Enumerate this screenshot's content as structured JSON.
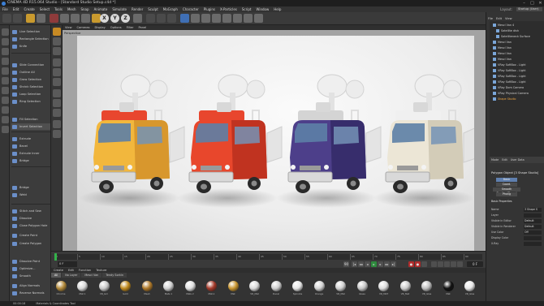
{
  "window": {
    "title": "CINEMA 4D R15.064 Studio - [Standard Studio Setup.c4d *]",
    "controls": [
      "–",
      "□",
      "✕"
    ]
  },
  "menubar": {
    "items": [
      "File",
      "Edit",
      "Create",
      "Select",
      "Tools",
      "Mesh",
      "Snap",
      "Animate",
      "Simulate",
      "Render",
      "Sculpt",
      "MoGraph",
      "Character",
      "Plugins",
      "X-Particles",
      "Script",
      "Window",
      "Help"
    ],
    "layout_label": "Layout:",
    "layout_value": "Startup (User)"
  },
  "toolbar": {
    "axis_labels": [
      "X",
      "Y",
      "Z"
    ]
  },
  "left_panel": {
    "items": [
      "Live Selection",
      "Rectangle Selection",
      "Knife",
      "",
      "Slide Connection",
      "Outline All",
      "Grow Selection",
      "Shrink Selection",
      "Loop Selection",
      "Ring Selection",
      "",
      "Fill Selection",
      "Invert Selection",
      "Extrude",
      "Bevel",
      "Extrude Inner",
      "Bridge",
      "",
      "Bridge",
      "Weld",
      "",
      "Stitch and Sew",
      "Dissolve",
      "Close Polygon Hole",
      "Create Point",
      "Create Polygon",
      "",
      "Dissolve Point",
      "Optimize...",
      "Smooth",
      "Align Normals",
      "Reverse Normals"
    ]
  },
  "viewport": {
    "menu": [
      "View",
      "Cameras",
      "Display",
      "Options",
      "Filter",
      "Panel"
    ],
    "label": "Perspective"
  },
  "timeline": {
    "ticks": [
      "0",
      "5",
      "10",
      "15",
      "20",
      "25",
      "30",
      "35",
      "40",
      "45",
      "50",
      "55",
      "60",
      "65",
      "70",
      "75",
      "80",
      "85",
      "90"
    ],
    "current_frame": "0 F",
    "end_frame": "90 F",
    "frame_right": "0 F"
  },
  "materials": {
    "tabs": [
      "Create",
      "Edit",
      "Function",
      "Texture"
    ],
    "filters": [
      "All",
      "No Layer",
      "Mesci Van",
      "Tendy Sorkin"
    ],
    "items": [
      {
        "name": "Chrome",
        "color": "#b38a3a"
      },
      {
        "name": "Mat 1",
        "color": "#d9d9d9"
      },
      {
        "name": "VR_Gm",
        "color": "#c9c9c9"
      },
      {
        "name": "Gold",
        "color": "#c08a1e"
      },
      {
        "name": "Mesh",
        "color": "#b07a2a"
      },
      {
        "name": "Mats 1",
        "color": "#d2d2d2"
      },
      {
        "name": "Mats 2",
        "color": "#e0e0e0"
      },
      {
        "name": "Mat.1",
        "color": "#a53a2a"
      },
      {
        "name": "Mat",
        "color": "#c8952f"
      },
      {
        "name": "VR_Mat",
        "color": "#dadada"
      },
      {
        "name": "Decal",
        "color": "#cfcfcf"
      },
      {
        "name": "Sprinkle",
        "color": "#e6e6e6"
      },
      {
        "name": "Orange",
        "color": "#d4d4d4"
      },
      {
        "name": "VR_Mat",
        "color": "#d0d0d0"
      },
      {
        "name": "Glass",
        "color": "#c7c7c7"
      },
      {
        "name": "VR_MAT",
        "color": "#dcdcdc"
      },
      {
        "name": "VR_Mat",
        "color": "#cccccc"
      },
      {
        "name": "VR_Glas",
        "color": "#bfbfbf"
      },
      {
        "name": "Mat",
        "color": "#111111"
      },
      {
        "name": "VR_Glas",
        "color": "#e8e8e8"
      }
    ]
  },
  "objects": {
    "menu": [
      "File",
      "Edit",
      "View"
    ],
    "items": [
      "Mesci Van 4",
      "Satellite dish",
      "Satelliteneck Surface",
      "Mesci Van",
      "Mesci Van",
      "Mesci Van",
      "Mesci Van",
      "VRay SoftBox - Light",
      "VRay SoftBox - Light",
      "VRay SoftBox - Light",
      "VRay SoftBox - Light",
      "VRay Dom Camera",
      "VRay Physical Camera",
      "Shape Studio"
    ],
    "selected_index": 13
  },
  "attributes": {
    "tabs": [
      "Mode",
      "Edit",
      "User Data"
    ],
    "title": "Polygon Object [3 Shape Studio]",
    "segments": [
      "Basic",
      "Coord.",
      "Phong",
      "Smooth Shading(Phong)"
    ],
    "section": "Basic Properties",
    "props": [
      {
        "label": "Name",
        "value": "3 Shape S"
      },
      {
        "label": "Layer",
        "value": ""
      },
      {
        "label": "Visible in Editor",
        "value": "Default"
      },
      {
        "label": "Visible in Renderer",
        "value": "Default"
      },
      {
        "label": "Use Color",
        "value": "Off"
      },
      {
        "label": "Display Color",
        "value": ""
      },
      {
        "label": "X-Ray",
        "value": ""
      }
    ]
  },
  "status": {
    "time": "00:00:18",
    "message": "Materials & Coordinates Tool"
  },
  "vans": [
    {
      "name": "yellow-van",
      "body": "#f2b73d",
      "shade": "#d3922a",
      "roof": "#e8462e"
    },
    {
      "name": "red-van",
      "body": "#e8472c",
      "shade": "#b8301f",
      "roof": "#e8462e"
    },
    {
      "name": "purple-van",
      "body": "#4d3f8a",
      "shade": "#342a66",
      "roof": "#d4d4d4"
    },
    {
      "name": "white-van",
      "body": "#ece6d6",
      "shade": "#cfc7b3",
      "roof": "#f0f0f0"
    }
  ]
}
